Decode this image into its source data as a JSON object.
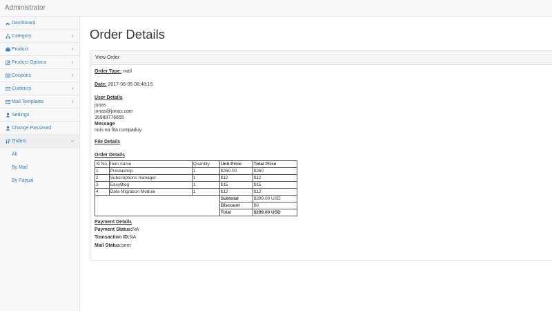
{
  "app": {
    "brand": "Administrator"
  },
  "sidebar": {
    "items": [
      {
        "label": "Dashboard",
        "icon": "dashboard-icon",
        "has_arrow": false
      },
      {
        "label": "Category",
        "icon": "sitemap-icon",
        "has_arrow": true
      },
      {
        "label": "Product",
        "icon": "briefcase-icon",
        "has_arrow": true
      },
      {
        "label": "Product Options",
        "icon": "checkbox-icon",
        "has_arrow": true
      },
      {
        "label": "Coupons",
        "icon": "list-icon",
        "has_arrow": true
      },
      {
        "label": "Currency",
        "icon": "money-icon",
        "has_arrow": true
      },
      {
        "label": "Mail Templates",
        "icon": "envelope-icon",
        "has_arrow": true
      },
      {
        "label": "Settings",
        "icon": "user-icon",
        "has_arrow": false
      },
      {
        "label": "Change Password",
        "icon": "user-icon",
        "has_arrow": false
      },
      {
        "label": "Orders",
        "icon": "sort-icon",
        "has_arrow": true
      }
    ],
    "orders_sub": [
      "All",
      "By Mail",
      "By Paypal"
    ]
  },
  "page": {
    "title": "Order Details",
    "panel_heading": "View Order"
  },
  "order": {
    "type_label": "Order Type:",
    "type_value": " mail",
    "date_label": "Date:",
    "date_value": " 2017-06-05 08:48:15",
    "user_details_label": "User Details",
    "user_name": "jonas",
    "user_email": "jonas@jonas.com",
    "user_phone": "35988776655",
    "message_label": "Message",
    "message_value": "nois na fita cumpaduy",
    "file_details_label": "File Details",
    "order_details_label": "Order Details",
    "table": {
      "headers": [
        "Sl No.",
        "Item name",
        "Quantity",
        "Unit Price",
        "Total Price"
      ],
      "rows": [
        [
          "1",
          "Prestashop",
          "1",
          "$260.00",
          "$260"
        ],
        [
          "2",
          "Subscriptions manager",
          "1",
          "$12",
          "$12"
        ],
        [
          "3",
          "EasyBlog",
          "1",
          "$15",
          "$15"
        ],
        [
          "4",
          "Data Migration Module",
          "1",
          "$12",
          "$12"
        ]
      ],
      "subtotal_label": "Subtotal",
      "subtotal_value": "$299.00 USD",
      "discount_label": "Discount",
      "discount_value": "$0",
      "total_label": "Total",
      "total_value": "$299.00 USD"
    },
    "payment_details_label": "Payment Details",
    "payment_status_label": "Payment Status:",
    "payment_status_value": "NA",
    "transaction_id_label": "Transaction ID:",
    "transaction_id_value": "NA",
    "mail_status_label": "Mail Status:",
    "mail_status_value": "sent"
  },
  "colors": {
    "link": "#337ab7",
    "text": "#333333",
    "sidebar_bg": "#f8f8f8",
    "border": "#e7e7e7"
  }
}
